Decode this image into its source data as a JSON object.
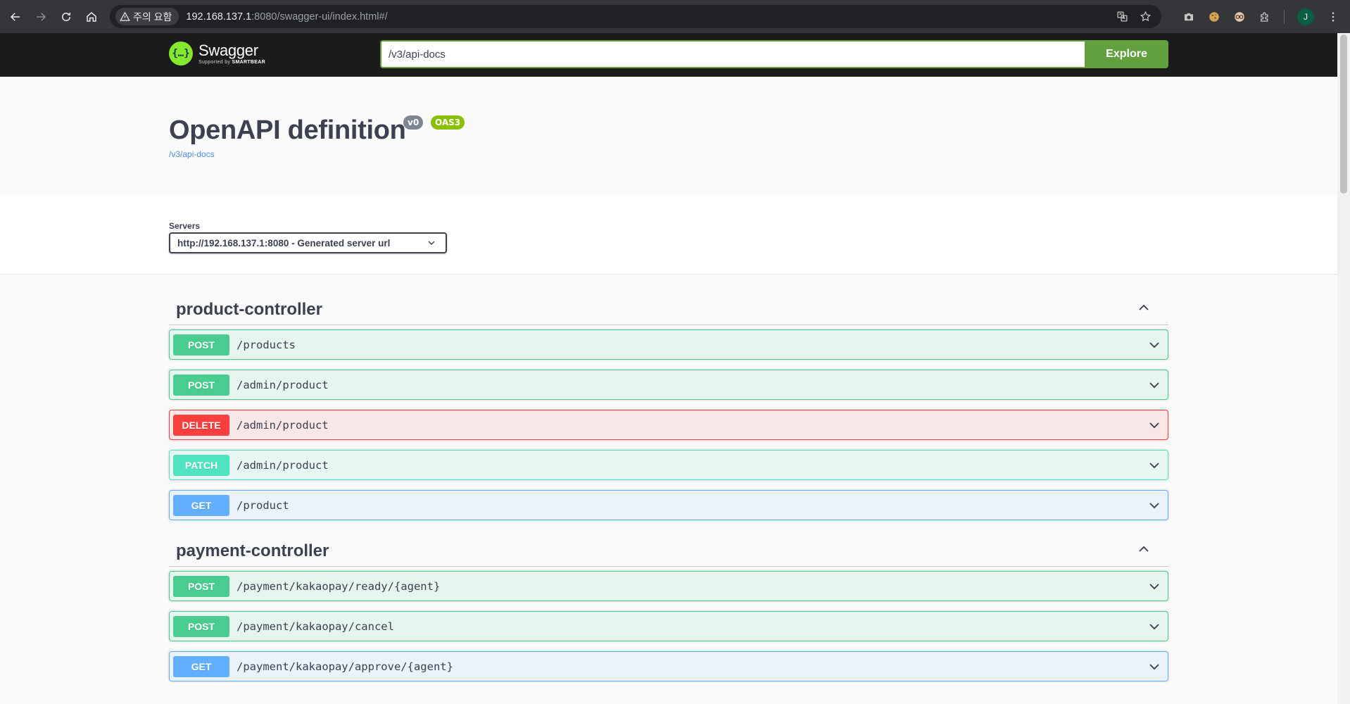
{
  "browser": {
    "security_label": "주의 요함",
    "url_host": "192.168.137.1",
    "url_rest": ":8080/swagger-ui/index.html#/",
    "profile_initial": "J"
  },
  "topbar": {
    "logo_title": "Swagger",
    "logo_sub_prefix": "Supported by ",
    "logo_sub_brand": "SMARTBEAR",
    "search_value": "/v3/api-docs",
    "explore_label": "Explore"
  },
  "info": {
    "title": "OpenAPI definition",
    "version": "v0",
    "oas": "OAS3",
    "link": "/v3/api-docs"
  },
  "servers": {
    "label": "Servers",
    "selected": "http://192.168.137.1:8080 - Generated server url"
  },
  "sections": [
    {
      "name": "product-controller",
      "operations": [
        {
          "method": "POST",
          "path": "/products"
        },
        {
          "method": "POST",
          "path": "/admin/product"
        },
        {
          "method": "DELETE",
          "path": "/admin/product"
        },
        {
          "method": "PATCH",
          "path": "/admin/product"
        },
        {
          "method": "GET",
          "path": "/product"
        }
      ]
    },
    {
      "name": "payment-controller",
      "operations": [
        {
          "method": "POST",
          "path": "/payment/kakaopay/ready/{agent}"
        },
        {
          "method": "POST",
          "path": "/payment/kakaopay/cancel"
        },
        {
          "method": "GET",
          "path": "/payment/kakaopay/approve/{agent}"
        }
      ]
    }
  ],
  "colors": {
    "post": "#49cc90",
    "delete": "#f93e3e",
    "patch": "#50e3c2",
    "get": "#61affe",
    "swagger_green": "#62a03f"
  }
}
